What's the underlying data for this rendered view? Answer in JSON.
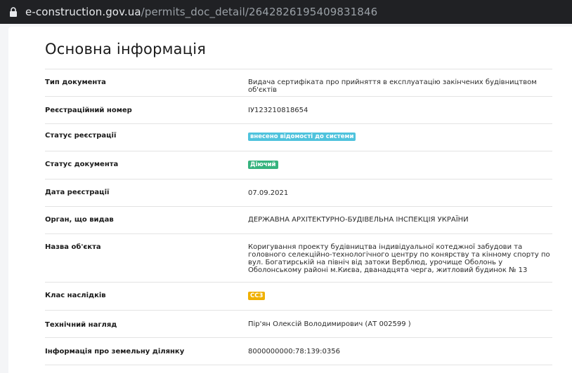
{
  "browser": {
    "url_host": "e-construction.gov.ua",
    "url_path": "/permits_doc_detail/2642826195409831846"
  },
  "main": {
    "title": "Основна інформація",
    "rows": [
      {
        "label": "Тип документа",
        "value": "Видача сертифіката про прийняття в експлуатацію закінчених будівництвом об'єктів"
      },
      {
        "label": "Реєстраційний номер",
        "value": "ІУ123210818654"
      },
      {
        "label": "Статус реєстрації",
        "value": "внесено відомості до системи"
      },
      {
        "label": "Статус документа",
        "value": "Діючий"
      },
      {
        "label": "Дата реєстрації",
        "value": "07.09.2021"
      },
      {
        "label": "Орган, що видав",
        "value": "ДЕРЖАВНА АРХІТЕКТУРНО-БУДІВЕЛЬНА ІНСПЕКЦІЯ УКРАЇНИ"
      },
      {
        "label": "Назва об'єкта",
        "value": "Коригування проекту будівництва індивідуальної котеджної забудови та головного селекційно-технологічного центру по конярству та кінному спорту по вул. Богатирській на північ від затоки Верблюд, урочище Оболонь у Оболонському районі м.Києва, дванадцята черга, житловий будинок № 13"
      },
      {
        "label": "Клас наслідків",
        "value": "СС3"
      },
      {
        "label": "Технічний нагляд",
        "value": "Пір'ян Олексій Володимирович (АТ 002599 )"
      },
      {
        "label": "Інформація про земельну ділянку",
        "value": "8000000000:78:139:0356"
      }
    ]
  },
  "colors": {
    "badge_info": "#4fc3dd",
    "badge_green": "#36b37e",
    "badge_warn": "#f0b000"
  }
}
